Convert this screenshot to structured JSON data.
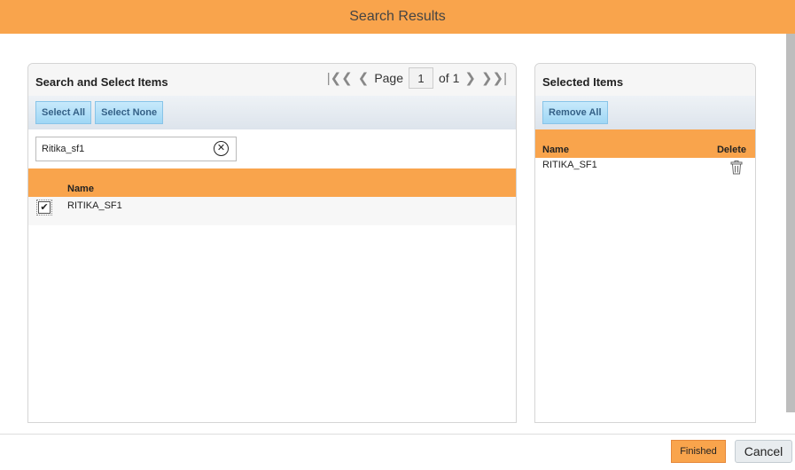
{
  "dialog": {
    "title": "Search Results"
  },
  "left_panel": {
    "title": "Search and Select Items",
    "pager": {
      "first_icon": "first-page-icon",
      "prev_icon": "prev-page-icon",
      "page_label": "Page",
      "current_page": "1",
      "of_label": "of 1",
      "next_icon": "next-page-icon",
      "last_icon": "last-page-icon"
    },
    "toolbar": {
      "select_all": "Select All",
      "select_none": "Select None"
    },
    "search": {
      "value": "Ritika_sf1",
      "clear_icon": "clear-circle-icon"
    },
    "table": {
      "columns": [
        "Name"
      ],
      "rows": [
        {
          "checked": true,
          "name": "RITIKA_SF1"
        }
      ]
    }
  },
  "right_panel": {
    "title": "Selected Items",
    "toolbar": {
      "remove_all": "Remove All"
    },
    "table": {
      "columns": [
        "Name",
        "Delete"
      ],
      "rows": [
        {
          "name": "RITIKA_SF1",
          "delete_icon": "trash-icon"
        }
      ]
    }
  },
  "footer": {
    "finished": "Finished",
    "cancel": "Cancel"
  },
  "colors": {
    "accent": "#f9a44c",
    "button_blue": "#9fd7f5"
  }
}
